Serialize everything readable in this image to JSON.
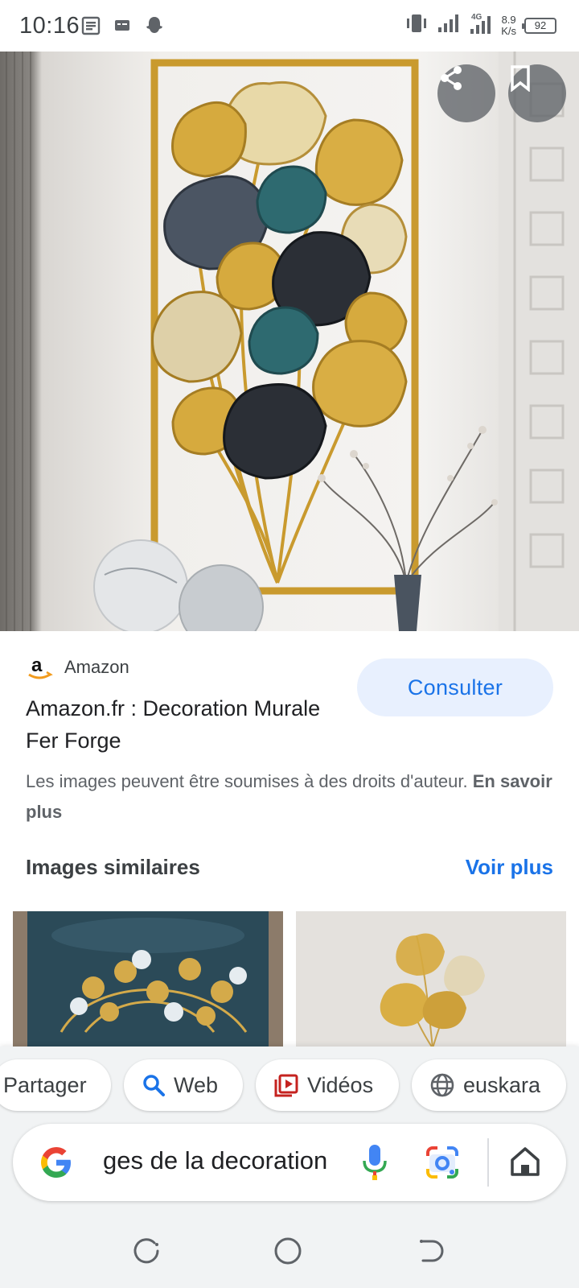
{
  "status_bar": {
    "time": "10:16",
    "net_speed_value": "8.9",
    "net_speed_unit": "K/s",
    "network_type": "4G",
    "battery": "92"
  },
  "hero": {
    "share_label": "share",
    "save_label": "save"
  },
  "result": {
    "source": "Amazon",
    "title": "Amazon.fr : Decoration Murale Fer Forge",
    "consult_label": "Consulter",
    "copyright_text": "Les images peuvent être soumises à des droits d'auteur.",
    "learn_more": "En savoir plus"
  },
  "similar": {
    "title": "Images similaires",
    "more_label": "Voir plus"
  },
  "chips": [
    {
      "label": "Partager",
      "icon": "share"
    },
    {
      "label": "Web",
      "icon": "search-icon"
    },
    {
      "label": "Vidéos",
      "icon": "video-icon"
    },
    {
      "label": "euskara",
      "icon": "globe-icon"
    }
  ],
  "search": {
    "query": "ges de la decoration"
  },
  "colors": {
    "accent": "#1a73e8",
    "chip_bg": "#e8f0fe",
    "sheet_bg": "#f1f3f4"
  }
}
